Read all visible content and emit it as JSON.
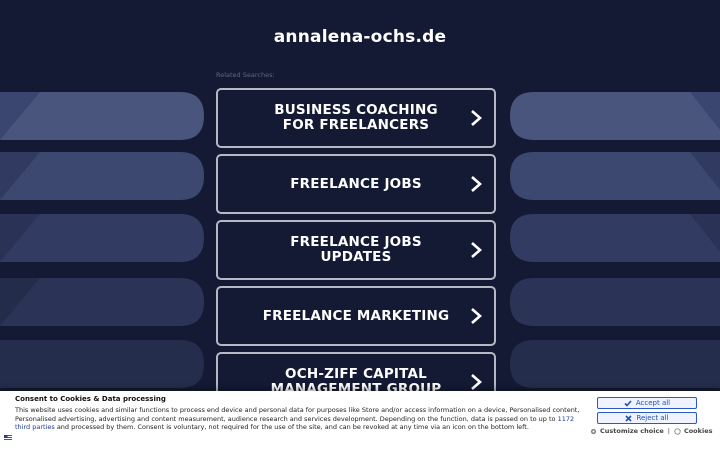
{
  "site": {
    "title": "annalena-ochs.de"
  },
  "related": {
    "heading": "Related Searches:"
  },
  "links": [
    {
      "label": "BUSINESS COACHING FOR FREELANCERS"
    },
    {
      "label": "FREELANCE JOBS"
    },
    {
      "label": "FREELANCE JOBS UPDATES"
    },
    {
      "label": "FREELANCE MARKETING"
    },
    {
      "label": "OCH-ZIFF CAPITAL MANAGEMENT GROUP"
    }
  ],
  "consent": {
    "title": "Consent to Cookies & Data processing",
    "text_part1": "This website uses cookies and similar functions to process end device and personal data for purposes like Store and/or access information on a device, Personalised content, Personalised advertising, advertising and content measurement, audience research and services development. Depending on the function, data is passed on to up to ",
    "third_parties_link": "1172 third parties",
    "text_part2": " and processed by them. Consent is voluntary, not required for the use of the site, and can be revoked at any time via an icon on the bottom left.",
    "accept_label": "Accept all",
    "reject_label": "Reject all",
    "customize_label": "Customize choice",
    "separator": "|",
    "cookies_label": "Cookies"
  },
  "colors": {
    "background": "#141a33",
    "box_border": "#b6b9c4",
    "accent_blue": "#2a57c9"
  },
  "icons": {
    "link_arrow": "chevron-right-icon",
    "accept": "check-icon",
    "reject": "x-icon",
    "customize": "gear-icon",
    "cookies": "cookie-icon",
    "flag": "us-flag-icon"
  }
}
